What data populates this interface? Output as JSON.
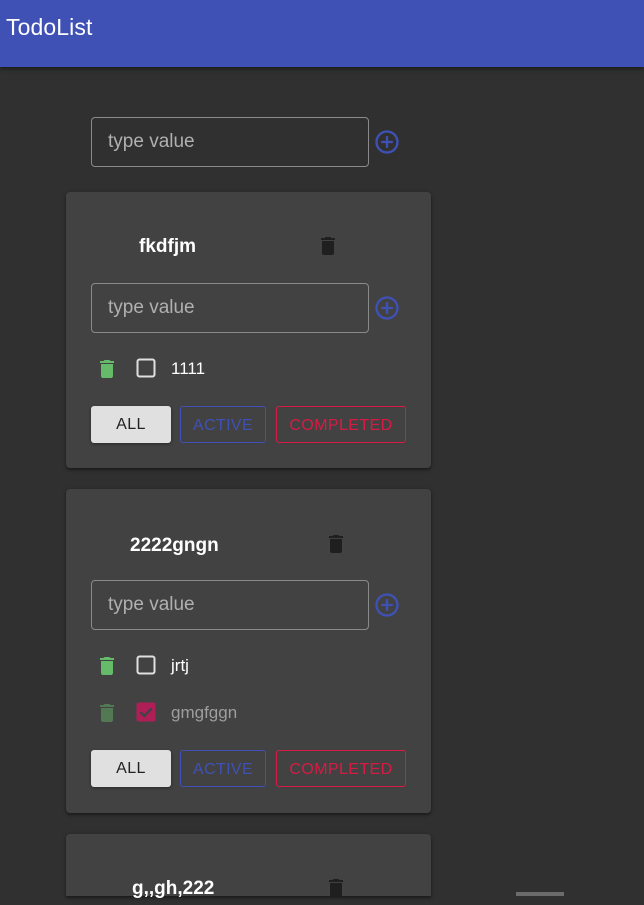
{
  "app": {
    "title": "TodoList"
  },
  "new_list": {
    "placeholder": "type value"
  },
  "todolists": [
    {
      "title": "fkdfjm",
      "input_placeholder": "type value",
      "tasks": [
        {
          "title": "1111",
          "done": false
        }
      ],
      "filters": {
        "all": "ALL",
        "active": "ACTIVE",
        "completed": "COMPLETED"
      }
    },
    {
      "title": "2222gngn",
      "input_placeholder": "type value",
      "tasks": [
        {
          "title": "jrtj",
          "done": false
        },
        {
          "title": "gmgfggn",
          "done": true
        }
      ],
      "filters": {
        "all": "ALL",
        "active": "ACTIVE",
        "completed": "COMPLETED"
      }
    },
    {
      "title": "g,,gh,222"
    }
  ],
  "colors": {
    "appbar": "#3f51b5",
    "background": "#303030",
    "card": "#424242",
    "task_trash": "#66bb6a",
    "checked": "#d81b45",
    "primary": "#3f51b5",
    "secondary": "#d81b45"
  },
  "icons": {
    "add": "add-circle-outline-icon",
    "delete_list": "trash-icon",
    "delete_task": "trash-icon",
    "checkbox": "checkbox-icon"
  }
}
